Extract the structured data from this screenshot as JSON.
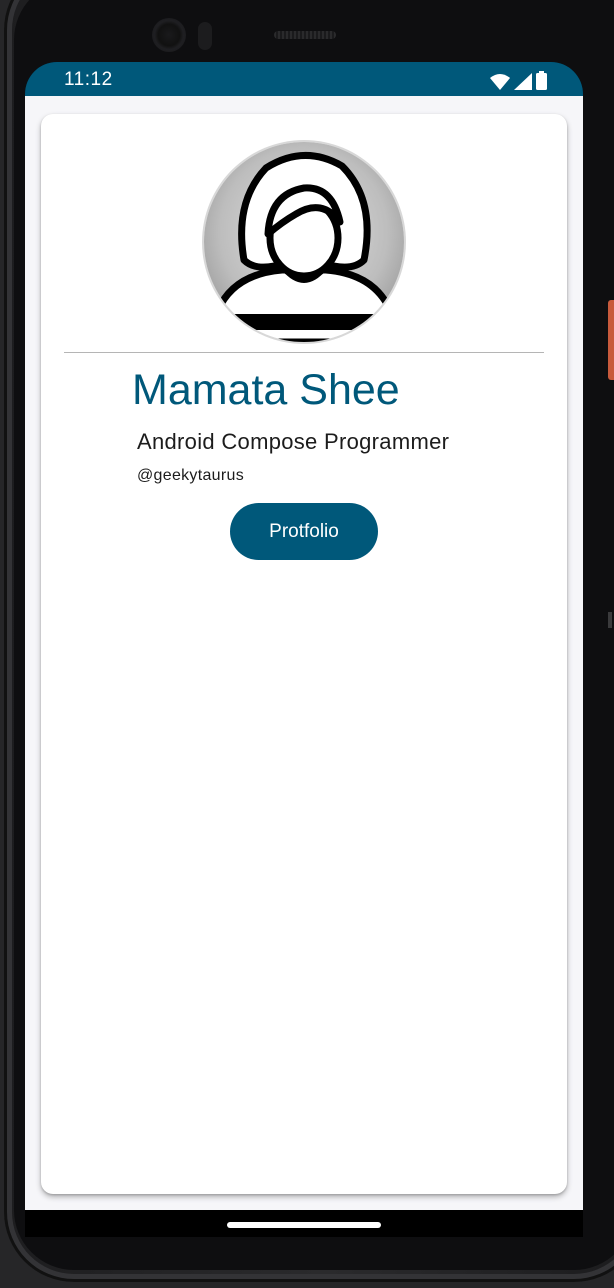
{
  "status_bar": {
    "time": "11:12",
    "icons": [
      "wifi-icon",
      "cellular-signal-icon",
      "battery-icon"
    ],
    "background": "#00587a"
  },
  "profile": {
    "avatar": "female-user-avatar",
    "name": "Mamata Shee",
    "title": "Android Compose Programmer",
    "handle": "@geekytaurus",
    "button_label": "Protfolio"
  },
  "colors": {
    "primary": "#00587a",
    "card": "#ffffff",
    "background": "#f6f6f9",
    "text": "#1c1c1c"
  }
}
